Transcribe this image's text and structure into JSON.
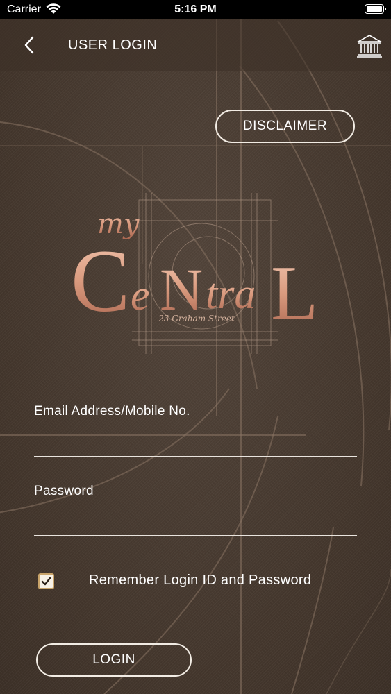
{
  "status_bar": {
    "carrier": "Carrier",
    "time": "5:16 PM",
    "wifi_icon": "wifi-icon",
    "battery_icon": "battery-icon"
  },
  "nav": {
    "back_icon": "chevron-left-icon",
    "title": "USER LOGIN",
    "building_icon": "building-icon"
  },
  "disclaimer_label": "DISCLAIMER",
  "logo": {
    "prefix": "my",
    "name": "CentraL",
    "tagline": "23 Graham Street"
  },
  "form": {
    "email_label": "Email Address/Mobile No.",
    "email_value": "",
    "password_label": "Password",
    "password_value": "",
    "remember_label": "Remember Login ID and Password",
    "remember_checked": true,
    "login_label": "LOGIN"
  },
  "colors": {
    "background": "#4a3c30",
    "accent_copper": "#d9a58c",
    "checkbox_border": "#c9a46a",
    "text": "#ffffff"
  }
}
